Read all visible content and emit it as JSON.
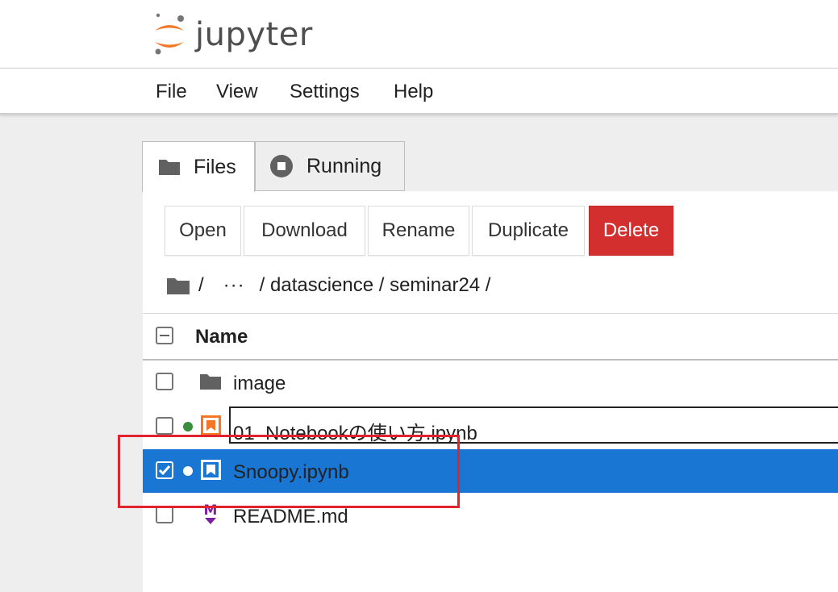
{
  "app": {
    "logo_text": "jupyter",
    "colors": {
      "accent": "#1976d2",
      "danger": "#d32f2f",
      "jupyter_orange": "#f37726",
      "markdown_purple": "#7b1fa2",
      "running_green": "#388e3c"
    }
  },
  "menu": {
    "items": [
      {
        "label": "File"
      },
      {
        "label": "View"
      },
      {
        "label": "Settings"
      },
      {
        "label": "Help"
      }
    ]
  },
  "tabs": [
    {
      "label": "Files",
      "icon": "folder-icon",
      "active": true
    },
    {
      "label": "Running",
      "icon": "stop-circle-icon",
      "active": false
    }
  ],
  "toolbar": {
    "open": "Open",
    "download": "Download",
    "rename": "Rename",
    "duplicate": "Duplicate",
    "delete": "Delete"
  },
  "breadcrumb": {
    "root_sep": "/",
    "ellipsis": "···",
    "path": "/ datascience / seminar24 /"
  },
  "file_list": {
    "column_name": "Name",
    "rows": [
      {
        "name": "image",
        "type": "folder",
        "icon": "folder-icon",
        "checked": false,
        "running": false
      },
      {
        "name": "01_Notebookの使い方.ipynb",
        "type": "notebook",
        "icon": "notebook-icon",
        "checked": false,
        "running": true
      },
      {
        "name": "Snoopy.ipynb",
        "type": "notebook",
        "icon": "notebook-icon",
        "checked": true,
        "running": true,
        "selected": true
      },
      {
        "name": "README.md",
        "type": "markdown",
        "icon": "markdown-icon",
        "checked": false,
        "running": false
      }
    ]
  }
}
